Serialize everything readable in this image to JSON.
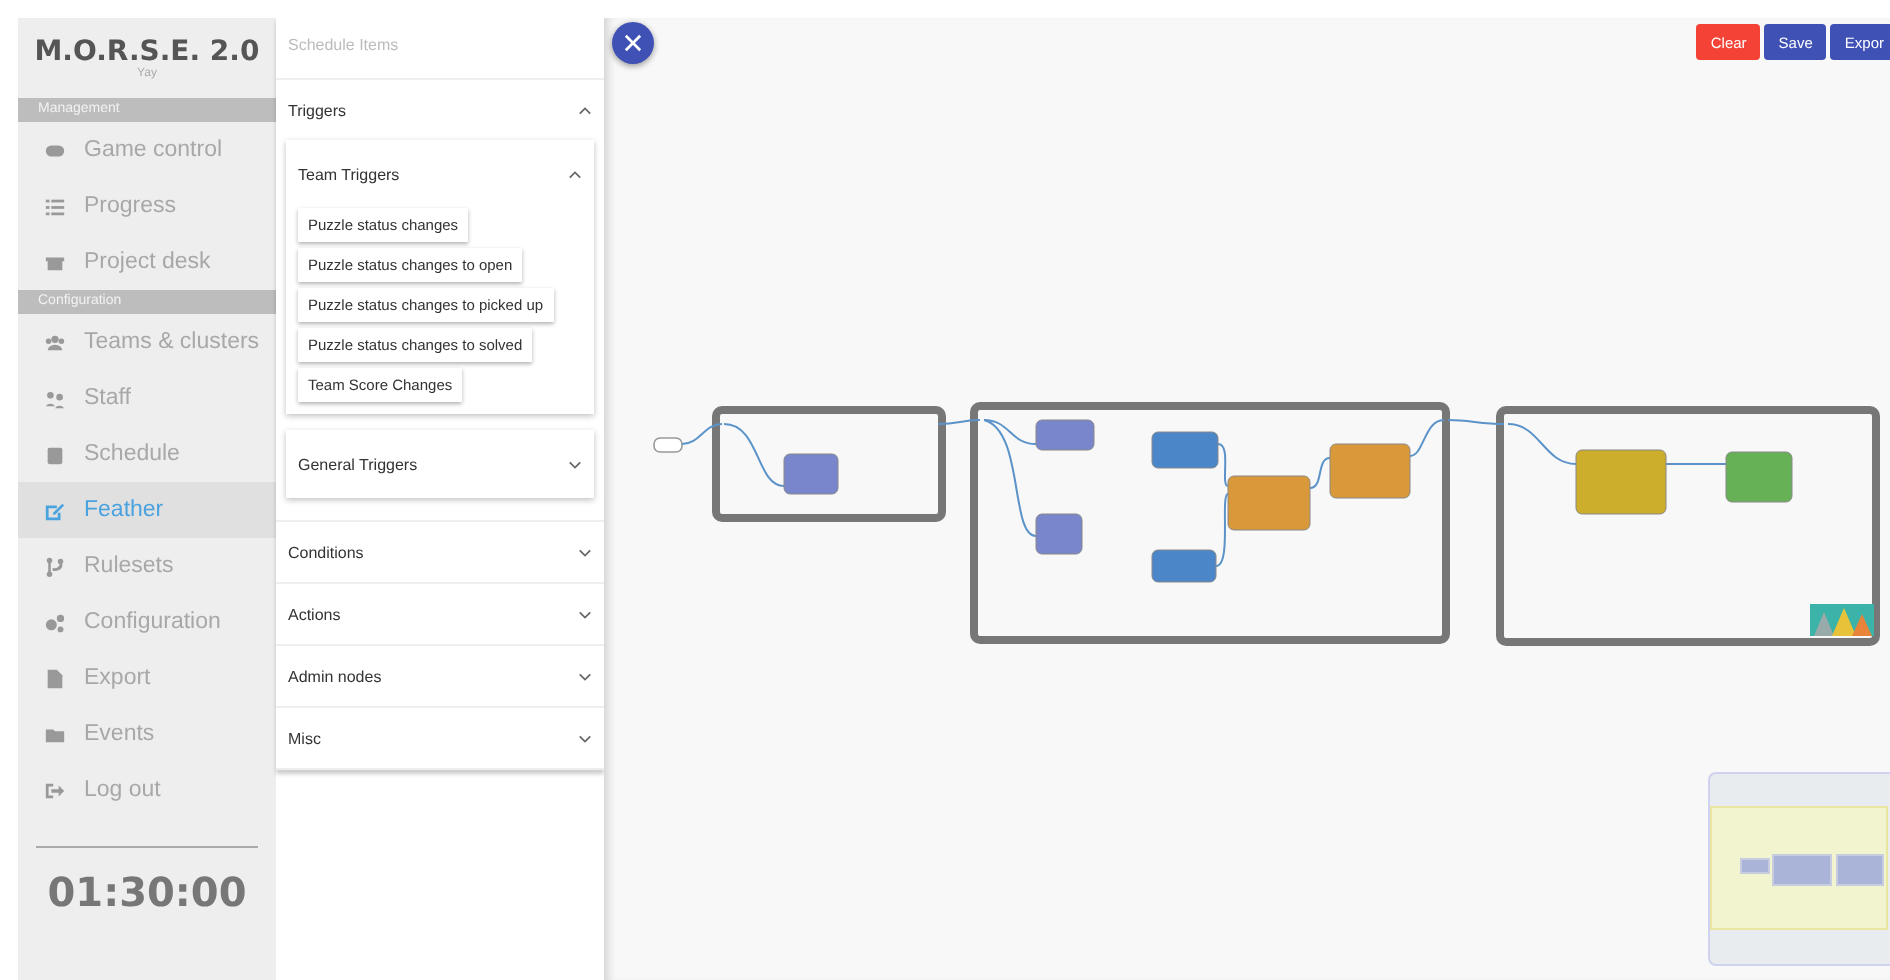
{
  "app": {
    "title": "M.O.R.S.E. 2.0",
    "subtitle": "Yay"
  },
  "sidebar": {
    "sections": [
      {
        "heading": "Management",
        "items": [
          {
            "label": "Game control",
            "selected": false
          },
          {
            "label": "Progress",
            "selected": false
          },
          {
            "label": "Project desk",
            "selected": false
          }
        ]
      },
      {
        "heading": "Configuration",
        "items": [
          {
            "label": "Teams & clusters",
            "selected": false
          },
          {
            "label": "Staff",
            "selected": false
          },
          {
            "label": "Schedule",
            "selected": false
          },
          {
            "label": "Feather",
            "selected": true
          },
          {
            "label": "Rulesets",
            "selected": false
          },
          {
            "label": "Configuration",
            "selected": false
          },
          {
            "label": "Export",
            "selected": false
          },
          {
            "label": "Events",
            "selected": false
          },
          {
            "label": "Log out",
            "selected": false
          }
        ]
      }
    ],
    "timer": "01:30:00"
  },
  "panel": {
    "title": "Schedule Items",
    "groups": [
      {
        "label": "Triggers",
        "expanded": true,
        "subgroups": [
          {
            "label": "Team Triggers",
            "expanded": true,
            "items": [
              "Puzzle status changes",
              "Puzzle status changes to open",
              "Puzzle status changes to picked up",
              "Puzzle status changes to solved",
              "Team Score Changes"
            ]
          },
          {
            "label": "General Triggers",
            "expanded": false
          }
        ]
      },
      {
        "label": "Conditions",
        "expanded": false
      },
      {
        "label": "Actions",
        "expanded": false
      },
      {
        "label": "Admin nodes",
        "expanded": false
      },
      {
        "label": "Misc",
        "expanded": false
      }
    ]
  },
  "toolbar": {
    "buttons": [
      {
        "label": "Clear",
        "kind": "danger"
      },
      {
        "label": "Save",
        "kind": "primary"
      },
      {
        "label": "Expor",
        "kind": "primary"
      }
    ]
  }
}
